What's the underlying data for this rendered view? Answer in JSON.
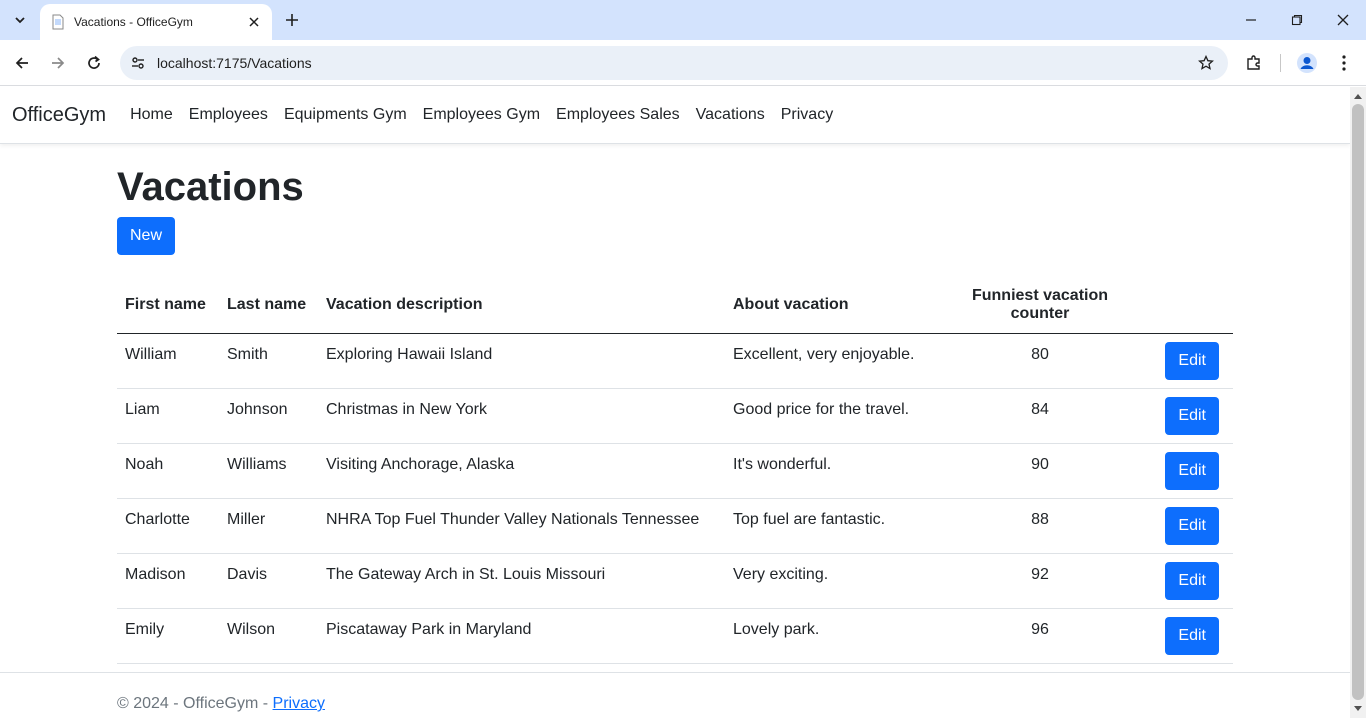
{
  "browser": {
    "tab_title": "Vacations - OfficeGym",
    "url": "localhost:7175/Vacations"
  },
  "site": {
    "brand": "OfficeGym",
    "nav": [
      {
        "label": "Home"
      },
      {
        "label": "Employees"
      },
      {
        "label": "Equipments Gym"
      },
      {
        "label": "Employees Gym"
      },
      {
        "label": "Employees Sales"
      },
      {
        "label": "Vacations"
      },
      {
        "label": "Privacy"
      }
    ]
  },
  "page": {
    "title": "Vacations",
    "new_label": "New",
    "edit_label": "Edit"
  },
  "table": {
    "headers": [
      "First name",
      "Last name",
      "Vacation description",
      "About vacation",
      "Funniest vacation counter"
    ],
    "rows": [
      {
        "first": "William",
        "last": "Smith",
        "description": "Exploring Hawaii Island",
        "about": "Excellent, very enjoyable.",
        "counter": "80"
      },
      {
        "first": "Liam",
        "last": "Johnson",
        "description": "Christmas in New York",
        "about": "Good price for the travel.",
        "counter": "84"
      },
      {
        "first": "Noah",
        "last": "Williams",
        "description": "Visiting Anchorage, Alaska",
        "about": "It's wonderful.",
        "counter": "90"
      },
      {
        "first": "Charlotte",
        "last": "Miller",
        "description": "NHRA Top Fuel Thunder Valley Nationals Tennessee",
        "about": "Top fuel are fantastic.",
        "counter": "88"
      },
      {
        "first": "Madison",
        "last": "Davis",
        "description": "The Gateway Arch in St. Louis Missouri",
        "about": "Very exciting.",
        "counter": "92"
      },
      {
        "first": "Emily",
        "last": "Wilson",
        "description": "Piscataway Park in Maryland",
        "about": "Lovely park.",
        "counter": "96"
      }
    ]
  },
  "footer": {
    "text": "© 2024 - OfficeGym - ",
    "link": "Privacy"
  },
  "colors": {
    "primary": "#0d6efd",
    "tabbar": "#d3e3fd",
    "omnibox": "#eaf0f8"
  }
}
